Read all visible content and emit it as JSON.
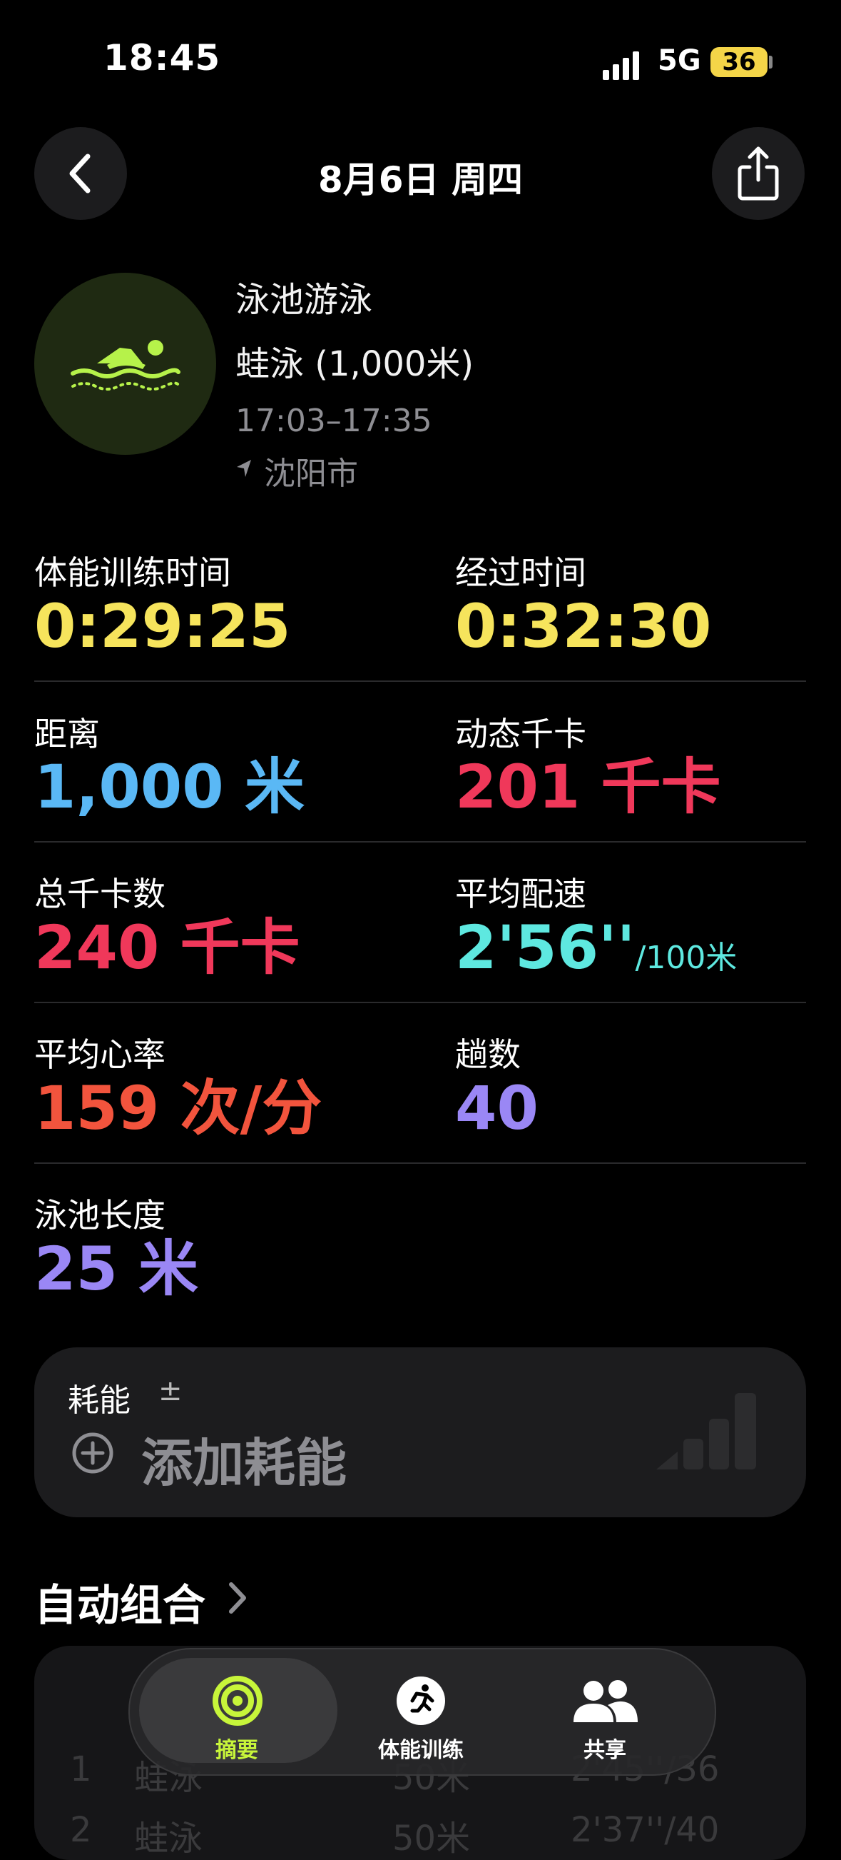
{
  "status_bar": {
    "time": "18:45",
    "network": "5G",
    "battery": "36"
  },
  "nav": {
    "title": "8月6日 周四",
    "back_icon": "chevron-left-icon",
    "share_icon": "share-icon"
  },
  "workout": {
    "name": "泳池游泳",
    "subtitle": "蛙泳 (1,000米)",
    "time_range": "17:03–17:35",
    "location": "沈阳市",
    "accent_color": "#b6f24a"
  },
  "stats": {
    "workout_time": {
      "label": "体能训练时间",
      "value": "0:29:25",
      "color": "#f6e45c"
    },
    "elapsed_time": {
      "label": "经过时间",
      "value": "0:32:30",
      "color": "#f6e45c"
    },
    "distance": {
      "label": "距离",
      "value": "1,000",
      "unit": "米",
      "color": "#5ab8f5"
    },
    "active_kcal": {
      "label": "动态千卡",
      "value": "201",
      "unit": "千卡",
      "color": "#f0385a"
    },
    "total_kcal": {
      "label": "总千卡数",
      "value": "240",
      "unit": "千卡",
      "color": "#f0385a"
    },
    "avg_pace": {
      "label": "平均配速",
      "value": "2'56''",
      "unit": "/100米",
      "color": "#5ee8e0"
    },
    "avg_hr": {
      "label": "平均心率",
      "value": "159",
      "unit": "次/分",
      "color": "#f2543d"
    },
    "laps": {
      "label": "趟数",
      "value": "40",
      "color": "#9a87f5"
    },
    "pool_length": {
      "label": "泳池长度",
      "value": "25",
      "unit": "米",
      "color": "#9a87f5"
    }
  },
  "effort": {
    "title": "耗能",
    "pm": "±",
    "add_label": "添加耗能"
  },
  "auto_sets": {
    "title": "自动组合",
    "rows": [
      {
        "num": "1",
        "stroke": "蛙泳",
        "dist": "50米",
        "pace": "2'45''/36"
      },
      {
        "num": "2",
        "stroke": "蛙泳",
        "dist": "50米",
        "pace": "2'37''/40"
      }
    ]
  },
  "tabbar": {
    "tabs": [
      {
        "label": "摘要",
        "icon": "activity-rings-icon",
        "active": true
      },
      {
        "label": "体能训练",
        "icon": "running-figure-icon",
        "active": false
      },
      {
        "label": "共享",
        "icon": "people-icon",
        "active": false
      }
    ]
  }
}
